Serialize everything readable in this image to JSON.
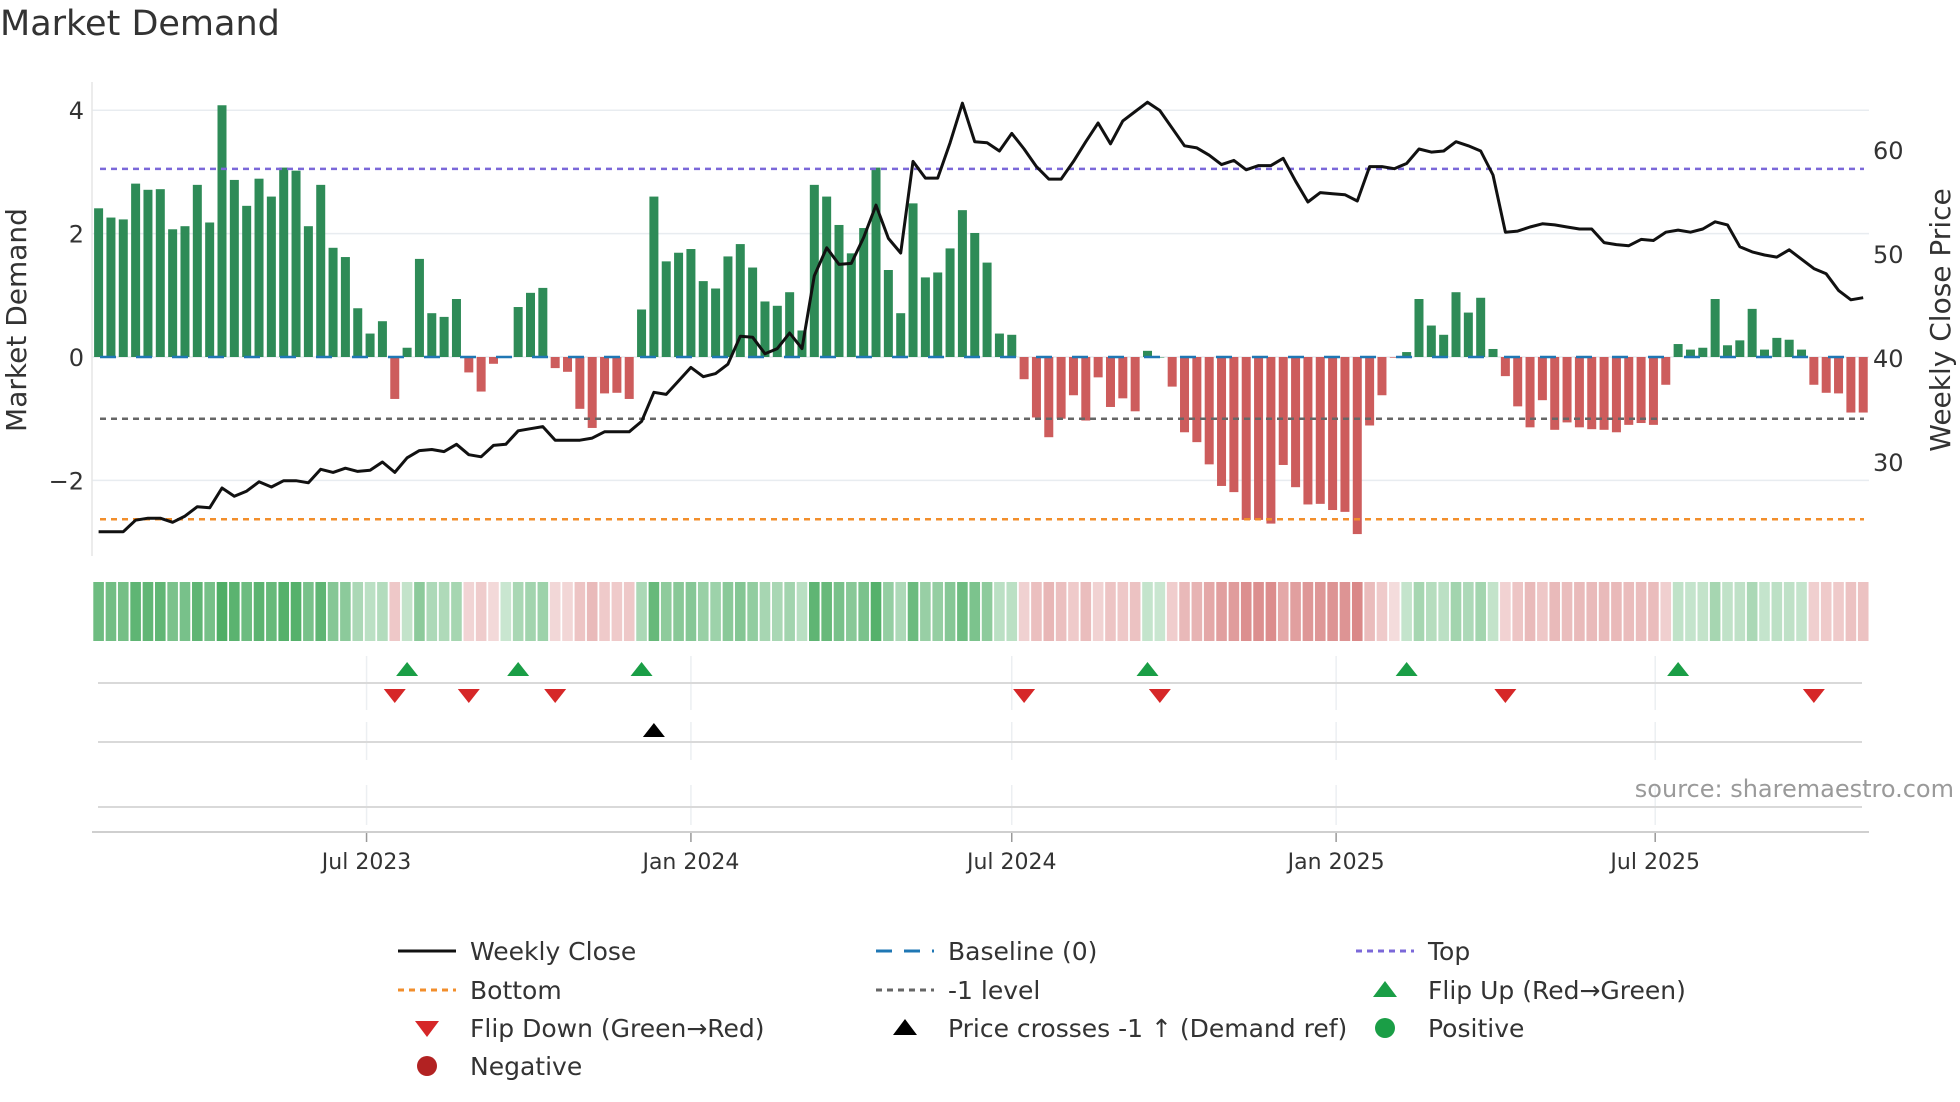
{
  "title": "Market Demand",
  "source": "source: sharemaestro.com",
  "legend": [
    {
      "label": "Weekly Close",
      "kind": "line",
      "color": "#111111"
    },
    {
      "label": "Baseline (0)",
      "kind": "dash",
      "color": "#1f77b4"
    },
    {
      "label": "Top",
      "kind": "dot",
      "color": "#7b68d9"
    },
    {
      "label": "Bottom",
      "kind": "dot",
      "color": "#f28e2b"
    },
    {
      "label": "-1 level",
      "kind": "dot",
      "color": "#666666"
    },
    {
      "label": "Flip Up (Red→Green)",
      "kind": "up",
      "color": "#1a9e46"
    },
    {
      "label": "Flip Down (Green→Red)",
      "kind": "down",
      "color": "#d62728"
    },
    {
      "label": "Price crosses -1 ↑ (Demand ref)",
      "kind": "up",
      "color": "#000000"
    },
    {
      "label": "Positive",
      "kind": "circle",
      "color": "#1a9e46"
    },
    {
      "label": "Negative",
      "kind": "circle",
      "color": "#b22222"
    }
  ],
  "colors": {
    "positive_bar": "#2e8b57",
    "negative_bar": "#cd5c5c",
    "price": "#111111"
  },
  "chart_data": {
    "type": "bar",
    "title": "Market Demand",
    "ylabel": "Market Demand",
    "y2label": "Weekly Close Price",
    "ylim": [
      -3.0,
      4.4
    ],
    "y2lim": [
      21.9,
      66.0
    ],
    "yticks": [
      {
        "v": 4,
        "label": "4"
      },
      {
        "v": 2,
        "label": "2"
      },
      {
        "v": 0,
        "label": "0"
      },
      {
        "v": -2,
        "label": "−2"
      }
    ],
    "y2ticks": [
      {
        "v": 60,
        "label": "60"
      },
      {
        "v": 50,
        "label": "50"
      },
      {
        "v": 40,
        "label": "40"
      },
      {
        "v": 30,
        "label": "30"
      }
    ],
    "x_start": "2023-01-30",
    "x_interval_days": 7,
    "xticks": [
      {
        "date": "2023-07-01",
        "label": "Jul 2023"
      },
      {
        "date": "2024-01-01",
        "label": "Jan 2024"
      },
      {
        "date": "2024-07-01",
        "label": "Jul 2024"
      },
      {
        "date": "2025-01-01",
        "label": "Jan 2025"
      },
      {
        "date": "2025-07-01",
        "label": "Jul 2025"
      }
    ],
    "levels": {
      "top": 3.05,
      "baseline": 0,
      "minus_one": -1,
      "bottom": -2.63
    },
    "demand": [
      2.41,
      2.26,
      2.23,
      2.81,
      2.71,
      2.72,
      2.07,
      2.12,
      2.79,
      2.18,
      4.08,
      2.87,
      2.45,
      2.89,
      2.6,
      3.07,
      3.02,
      2.12,
      2.79,
      1.77,
      1.62,
      0.79,
      0.38,
      0.58,
      -0.68,
      0.15,
      1.59,
      0.71,
      0.65,
      0.94,
      -0.25,
      -0.56,
      -0.11,
      0.01,
      0.81,
      1.04,
      1.12,
      -0.18,
      -0.24,
      -0.84,
      -1.15,
      -0.59,
      -0.58,
      -0.68,
      0.77,
      2.6,
      1.55,
      1.69,
      1.75,
      1.23,
      1.11,
      1.63,
      1.83,
      1.45,
      0.9,
      0.83,
      1.05,
      0.43,
      2.79,
      2.6,
      2.14,
      1.68,
      2.09,
      3.07,
      1.41,
      0.71,
      2.49,
      1.29,
      1.37,
      1.76,
      2.38,
      2.01,
      1.53,
      0.38,
      0.36,
      -0.36,
      -0.98,
      -1.3,
      -1.0,
      -0.62,
      -1.03,
      -0.33,
      -0.81,
      -0.67,
      -0.88,
      0.1,
      0.0,
      -0.48,
      -1.22,
      -1.38,
      -1.74,
      -2.09,
      -2.19,
      -2.64,
      -2.64,
      -2.7,
      -1.75,
      -2.11,
      -2.39,
      -2.38,
      -2.48,
      -2.51,
      -2.87,
      -1.11,
      -0.62,
      -0.01,
      0.08,
      0.94,
      0.51,
      0.36,
      1.05,
      0.72,
      0.96,
      0.13,
      -0.31,
      -0.8,
      -1.14,
      -0.7,
      -1.18,
      -1.06,
      -1.14,
      -1.17,
      -1.18,
      -1.22,
      -1.1,
      -1.07,
      -1.1,
      -0.45,
      0.21,
      0.12,
      0.15,
      0.94,
      0.19,
      0.27,
      0.78,
      0.12,
      0.31,
      0.28,
      0.12,
      -0.45,
      -0.58,
      -0.59,
      -0.9,
      -0.9
    ],
    "price": [
      23.3,
      23.3,
      23.3,
      24.4,
      24.6,
      24.6,
      24.2,
      24.8,
      25.7,
      25.6,
      27.5,
      26.7,
      27.2,
      28.1,
      27.6,
      28.2,
      28.2,
      28.0,
      29.3,
      29.0,
      29.4,
      29.1,
      29.2,
      30.0,
      29.0,
      30.4,
      31.1,
      31.2,
      31.0,
      31.7,
      30.7,
      30.5,
      31.6,
      31.7,
      33.0,
      33.2,
      33.4,
      32.1,
      32.1,
      32.1,
      32.3,
      32.9,
      32.9,
      32.9,
      33.9,
      36.7,
      36.5,
      37.8,
      39.1,
      38.2,
      38.5,
      39.4,
      42.1,
      42.0,
      40.4,
      40.9,
      42.4,
      40.9,
      47.9,
      50.6,
      49.0,
      49.1,
      51.6,
      54.7,
      51.5,
      50.1,
      58.9,
      57.3,
      57.3,
      60.7,
      64.5,
      60.8,
      60.7,
      59.9,
      61.6,
      60.1,
      58.4,
      57.2,
      57.2,
      58.9,
      60.8,
      62.6,
      60.6,
      62.8,
      63.7,
      64.6,
      63.8,
      62.1,
      60.4,
      60.2,
      59.5,
      58.6,
      59.0,
      58.1,
      58.5,
      58.5,
      59.2,
      57.0,
      55.0,
      55.9,
      55.8,
      55.7,
      55.1,
      58.4,
      58.4,
      58.2,
      58.7,
      60.1,
      59.8,
      59.9,
      60.8,
      60.4,
      59.9,
      57.6,
      52.1,
      52.2,
      52.6,
      52.9,
      52.8,
      52.6,
      52.4,
      52.4,
      51.1,
      50.9,
      50.8,
      51.4,
      51.3,
      52.1,
      52.3,
      52.1,
      52.4,
      53.1,
      52.8,
      50.7,
      50.2,
      49.9,
      49.7,
      50.4,
      49.5,
      48.6,
      48.1,
      46.5,
      45.6,
      45.8
    ],
    "flip_up_weeks": [
      26,
      35,
      45,
      86,
      107,
      129
    ],
    "flip_down_weeks": [
      25,
      31,
      38,
      76,
      87,
      115,
      140
    ],
    "price_cross_weeks": [
      46
    ]
  }
}
